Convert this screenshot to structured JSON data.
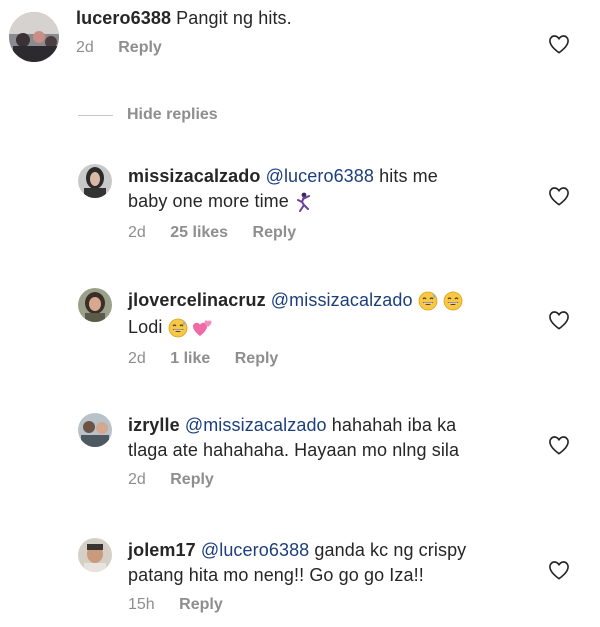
{
  "comments": [
    {
      "username": "lucero6388",
      "mention": "",
      "line1": "Pangit ng hits.",
      "line2": "",
      "time": "2d",
      "likes": "",
      "reply_label": "Reply"
    },
    {
      "username": "missizacalzado",
      "mention": "@lucero6388",
      "line1": " hits me",
      "line2": "baby one more time",
      "time": "2d",
      "likes": "25 likes",
      "reply_label": "Reply"
    },
    {
      "username": "jlovercelinacruz",
      "mention": "@missizacalzado",
      "line1": "",
      "line2": "Lodi",
      "time": "2d",
      "likes": "1 like",
      "reply_label": "Reply"
    },
    {
      "username": "izrylle",
      "mention": "@missizacalzado",
      "line1": " hahahah iba ka",
      "line2": "tlaga ate hahahaha. Hayaan mo nlng sila",
      "time": "2d",
      "likes": "",
      "reply_label": "Reply"
    },
    {
      "username": "jolem17",
      "mention": "@lucero6388",
      "line1": " ganda kc ng crispy",
      "line2": "patang hita mo neng!! Go go go Iza!!",
      "time": "15h",
      "likes": "",
      "reply_label": "Reply"
    }
  ],
  "thread": {
    "hide_replies_label": "Hide replies"
  },
  "icons": {
    "like": "heart-outline-icon",
    "dancer_emoji": "dancer-emoji",
    "laughing_emoji": "grinning-sweat-emoji",
    "hearts_emoji": "two-hearts-emoji"
  },
  "colors": {
    "text": "#262626",
    "meta": "#8e8e8e",
    "mention": "#1c3f7c"
  }
}
